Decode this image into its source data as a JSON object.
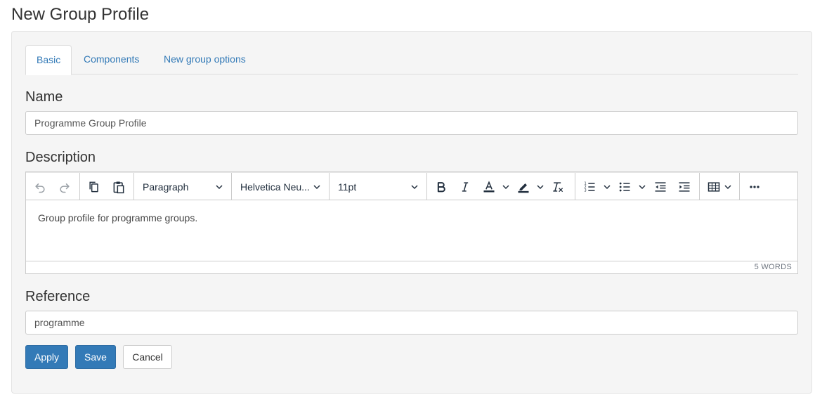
{
  "page": {
    "title": "New Group Profile"
  },
  "tabs": [
    {
      "label": "Basic",
      "active": true
    },
    {
      "label": "Components",
      "active": false
    },
    {
      "label": "New group options",
      "active": false
    }
  ],
  "fields": {
    "name": {
      "label": "Name",
      "value": "Programme Group Profile"
    },
    "description": {
      "label": "Description"
    },
    "reference": {
      "label": "Reference",
      "value": "programme"
    }
  },
  "editor": {
    "toolbar": {
      "icons": [
        "undo-icon",
        "redo-icon",
        "copy-icon",
        "paste-icon",
        "bold-icon",
        "italic-icon",
        "text-color-icon",
        "highlight-color-icon",
        "clear-formatting-icon",
        "numbered-list-icon",
        "bullet-list-icon",
        "outdent-icon",
        "indent-icon",
        "table-icon",
        "more-icon"
      ],
      "block_format": "Paragraph",
      "font_family": "Helvetica Neu...",
      "font_size": "11pt"
    },
    "content": "Group profile for programme groups.",
    "word_count": "5 WORDS"
  },
  "buttons": {
    "apply": "Apply",
    "save": "Save",
    "cancel": "Cancel"
  },
  "colors": {
    "link": "#337ab7",
    "primary_button": "#337ab7",
    "well_background": "#f5f5f5",
    "text_color_swatch": "#222f3e"
  }
}
